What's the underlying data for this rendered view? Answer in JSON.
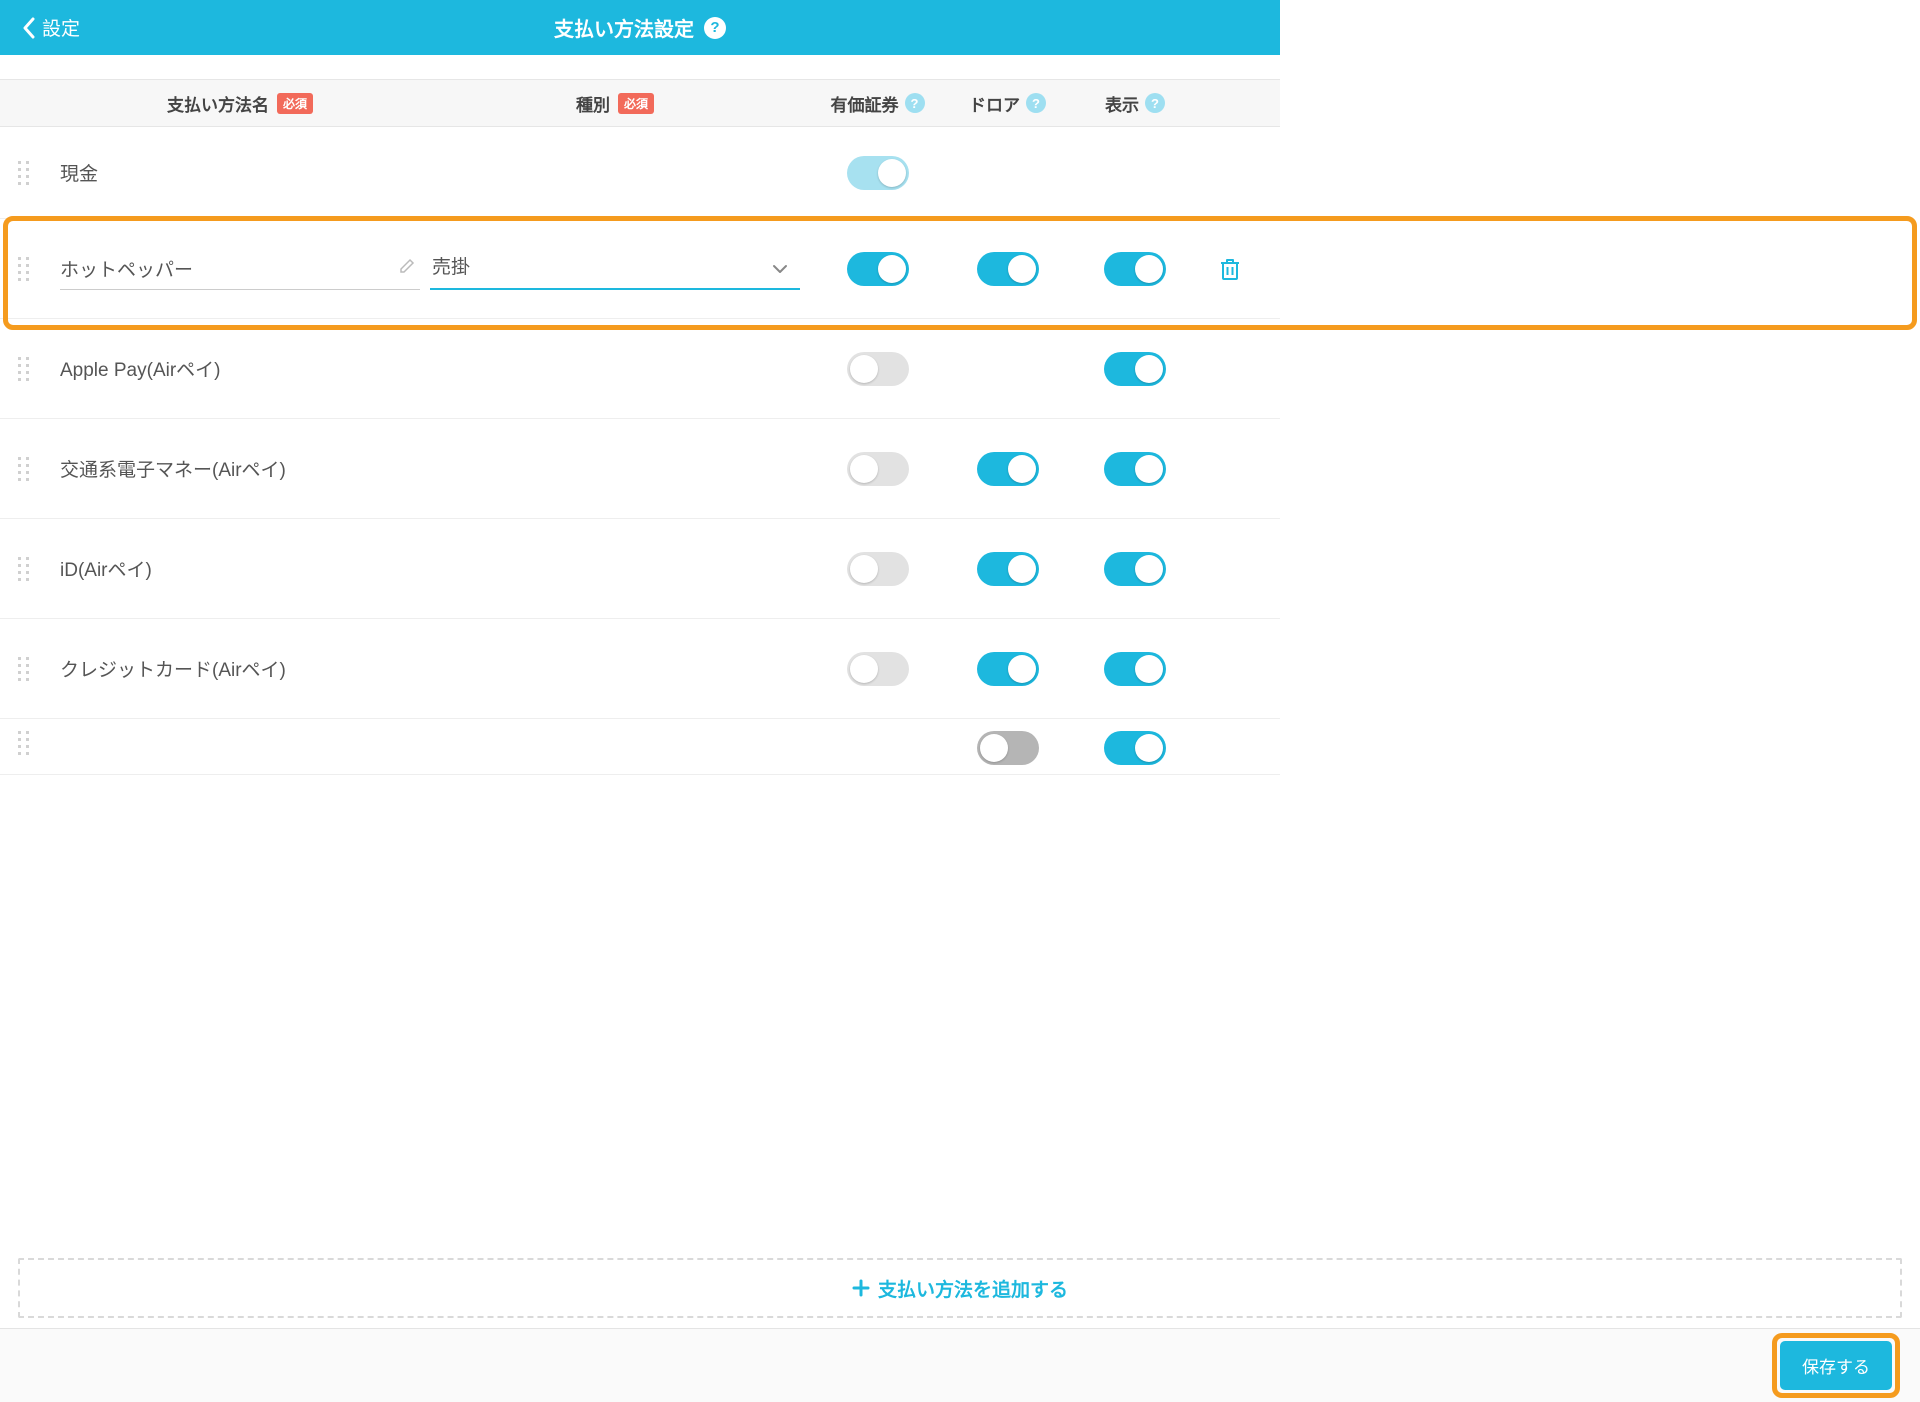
{
  "header": {
    "back_label": "設定",
    "title": "支払い方法設定"
  },
  "columns": {
    "name": "支払い方法名",
    "type": "種別",
    "securities": "有価証券",
    "drawer": "ドロア",
    "display": "表示",
    "required": "必須"
  },
  "rows": [
    {
      "name": "現金",
      "editable": false,
      "type": null,
      "sec": "on-light",
      "drw": null,
      "disp": null,
      "deletable": false
    },
    {
      "name": "ホットペッパー",
      "editable": true,
      "type": "売掛",
      "sec": "on",
      "drw": "on",
      "disp": "on",
      "deletable": true
    },
    {
      "name": "Apple Pay(Airペイ)",
      "editable": false,
      "type": null,
      "sec": "off",
      "drw": null,
      "disp": "on",
      "deletable": false
    },
    {
      "name": "交通系電子マネー(Airペイ)",
      "editable": false,
      "type": null,
      "sec": "off",
      "drw": "on",
      "disp": "on",
      "deletable": false
    },
    {
      "name": "iD(Airペイ)",
      "editable": false,
      "type": null,
      "sec": "off",
      "drw": "on",
      "disp": "on",
      "deletable": false
    },
    {
      "name": "クレジットカード(Airペイ)",
      "editable": false,
      "type": null,
      "sec": "off",
      "drw": "on",
      "disp": "on",
      "deletable": false
    },
    {
      "name": "",
      "editable": false,
      "type": null,
      "sec": null,
      "drw": "offdark",
      "disp": "on",
      "deletable": false,
      "halfcut": true
    }
  ],
  "add_label": "支払い方法を追加する",
  "save_label": "保存する"
}
